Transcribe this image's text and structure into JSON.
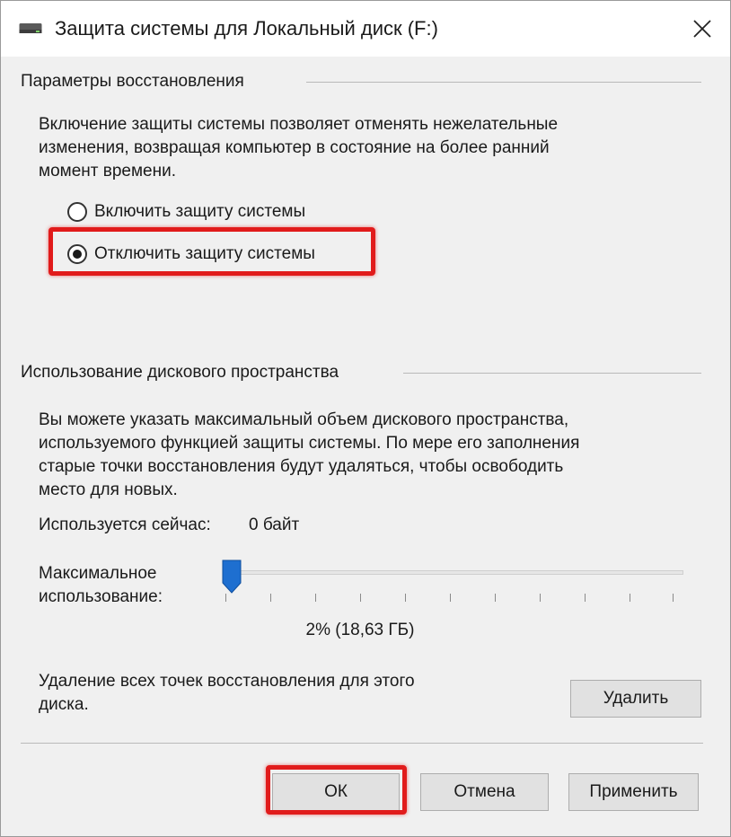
{
  "window": {
    "title": "Защита системы для Локальный диск (F:)",
    "icon": "drive-icon",
    "close_glyph": "✕"
  },
  "restore_group": {
    "title": "Параметры восстановления",
    "description": [
      "Включение защиты системы позволяет отменять нежелательные",
      "изменения, возвращая компьютер в состояние на более ранний",
      "момент времени."
    ],
    "options": [
      {
        "label": "Включить защиту системы",
        "checked": false
      },
      {
        "label": "Отключить защиту системы",
        "checked": true
      }
    ]
  },
  "disk_group": {
    "title": "Использование дискового пространства",
    "description": [
      "Вы можете указать максимальный объем дискового пространства,",
      "используемого функцией защиты системы. По мере его заполнения",
      "старые точки восстановления будут удаляться, чтобы освободить",
      "место для новых."
    ],
    "current_usage_label": "Используется сейчас:",
    "current_usage_value": "0 байт",
    "max_usage_label": [
      "Максимальное",
      "использование:"
    ],
    "max_usage_percent": 2,
    "max_usage_text": "2% (18,63 ГБ)",
    "delete_text": [
      "Удаление всех точек восстановления для этого",
      "диска."
    ],
    "delete_button": "Удалить"
  },
  "footer": {
    "ok": "ОК",
    "cancel": "Отмена",
    "apply": "Применить"
  },
  "colors": {
    "highlight": "#e11b1b",
    "slider_thumb": "#1e6fd0",
    "background": "#f0f0f0"
  }
}
